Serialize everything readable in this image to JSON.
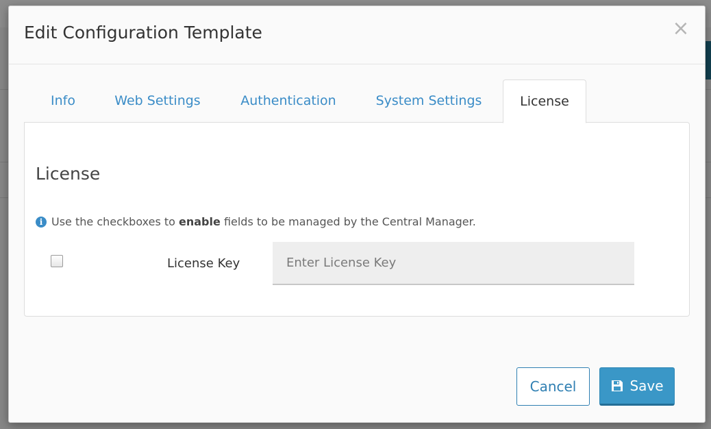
{
  "modal": {
    "title": "Edit Configuration Template",
    "close_glyph": "×"
  },
  "tabs": [
    {
      "label": "Info"
    },
    {
      "label": "Web Settings"
    },
    {
      "label": "Authentication"
    },
    {
      "label": "System Settings"
    },
    {
      "label": "License",
      "active": true
    }
  ],
  "panel": {
    "heading": "License",
    "info": {
      "icon": "info-circle-icon",
      "prefix": "Use the checkboxes to",
      "emphasis": "enable",
      "suffix": "fields to be managed by the Central Manager."
    },
    "license_key": {
      "label": "License Key",
      "placeholder": "Enter License Key",
      "value": "",
      "enabled_checked": false
    }
  },
  "footer": {
    "cancel_label": "Cancel",
    "save_label": "Save",
    "save_icon": "floppy-disk-icon"
  },
  "colors": {
    "link": "#3a8cc7",
    "primary": "#3a97c7"
  }
}
